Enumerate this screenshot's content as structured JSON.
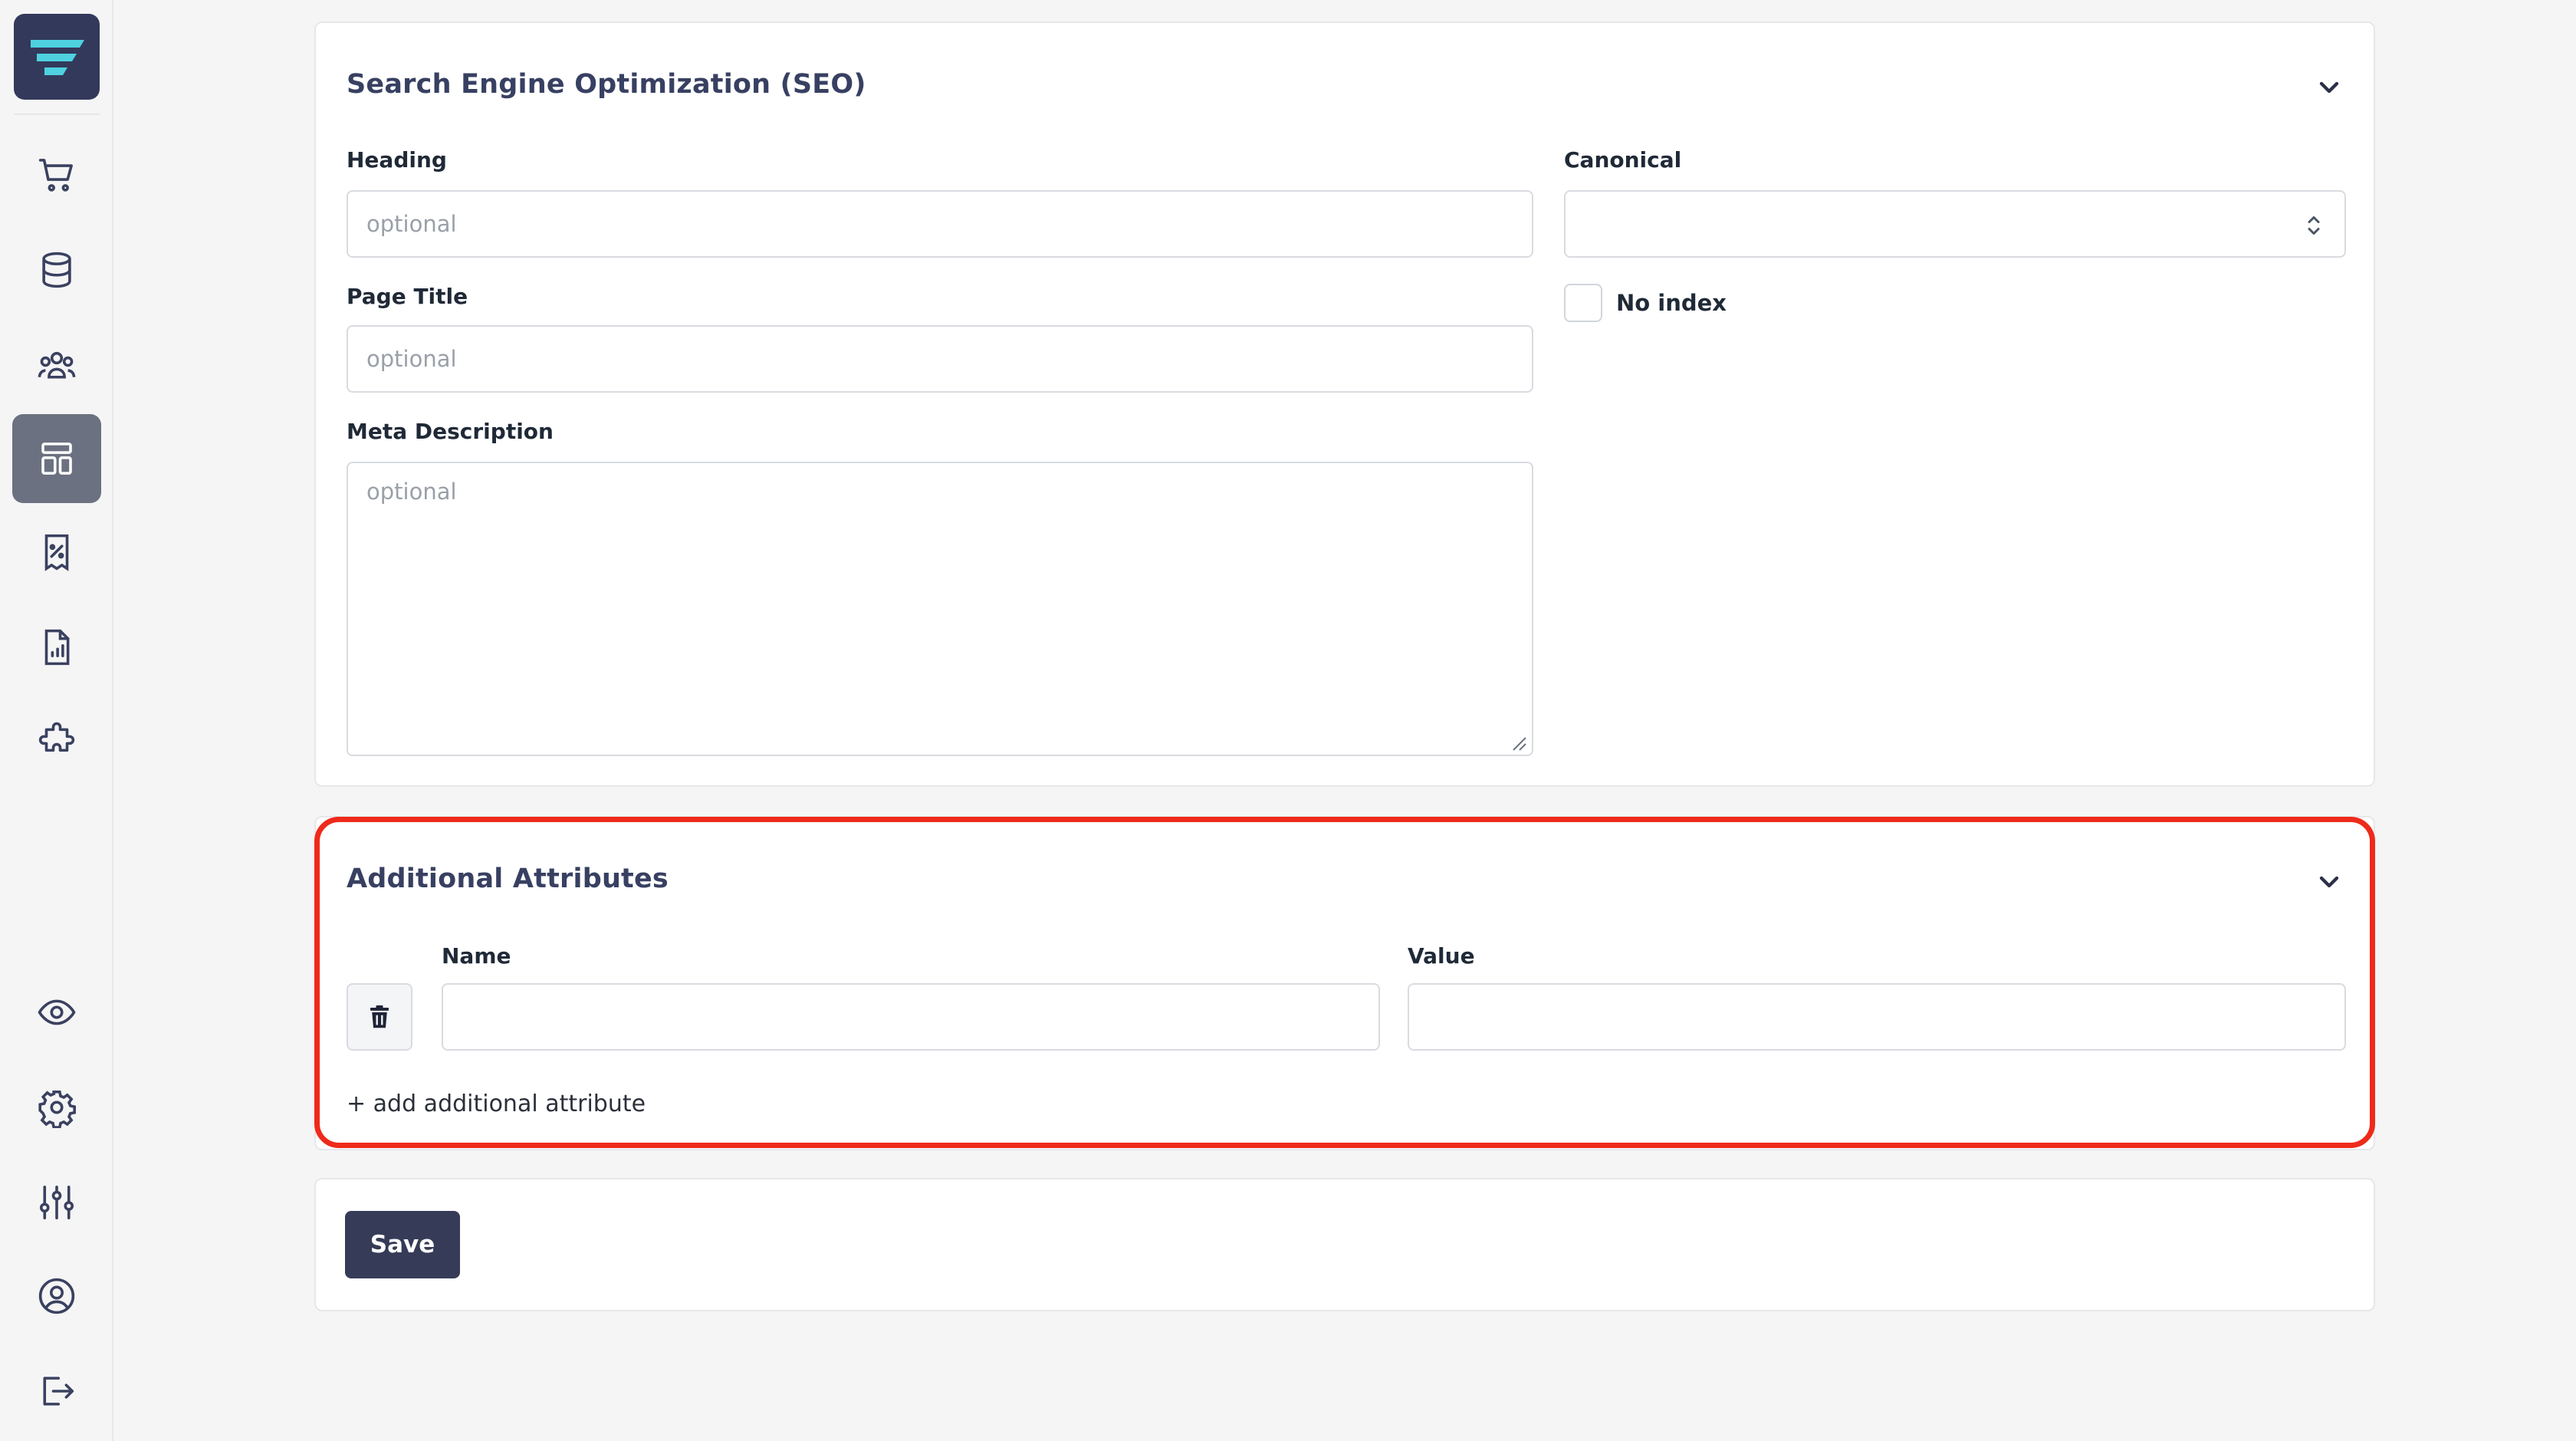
{
  "sidebar": {
    "logo_icon": "app-logo",
    "items": [
      {
        "icon": "cart-icon"
      },
      {
        "icon": "database-icon"
      },
      {
        "icon": "users-icon"
      },
      {
        "icon": "layout-icon",
        "active": true
      },
      {
        "icon": "receipt-percent-icon"
      },
      {
        "icon": "document-chart-icon"
      },
      {
        "icon": "puzzle-icon"
      }
    ],
    "bottom_items": [
      {
        "icon": "eye-icon"
      },
      {
        "icon": "gear-icon"
      },
      {
        "icon": "sliders-icon"
      },
      {
        "icon": "user-circle-icon"
      },
      {
        "icon": "logout-icon"
      }
    ],
    "active_color": "#6b7180"
  },
  "seo": {
    "title": "Search Engine Optimization (SEO)",
    "heading_label": "Heading",
    "heading_placeholder": "optional",
    "heading_value": "",
    "page_title_label": "Page Title",
    "page_title_placeholder": "optional",
    "page_title_value": "",
    "meta_label": "Meta Description",
    "meta_placeholder": "optional",
    "meta_value": "",
    "canonical_label": "Canonical",
    "canonical_value": "",
    "noindex_label": "No index",
    "noindex_checked": false
  },
  "attributes": {
    "title": "Additional Attributes",
    "name_label": "Name",
    "value_label": "Value",
    "rows": [
      {
        "name": "",
        "value": ""
      }
    ],
    "add_label": "+ add additional attribute"
  },
  "footer": {
    "save_label": "Save"
  },
  "colors": {
    "brand": "#33395a",
    "accent": "#4fd1e0",
    "highlight": "#ef2a1a",
    "button": "#363b57"
  }
}
